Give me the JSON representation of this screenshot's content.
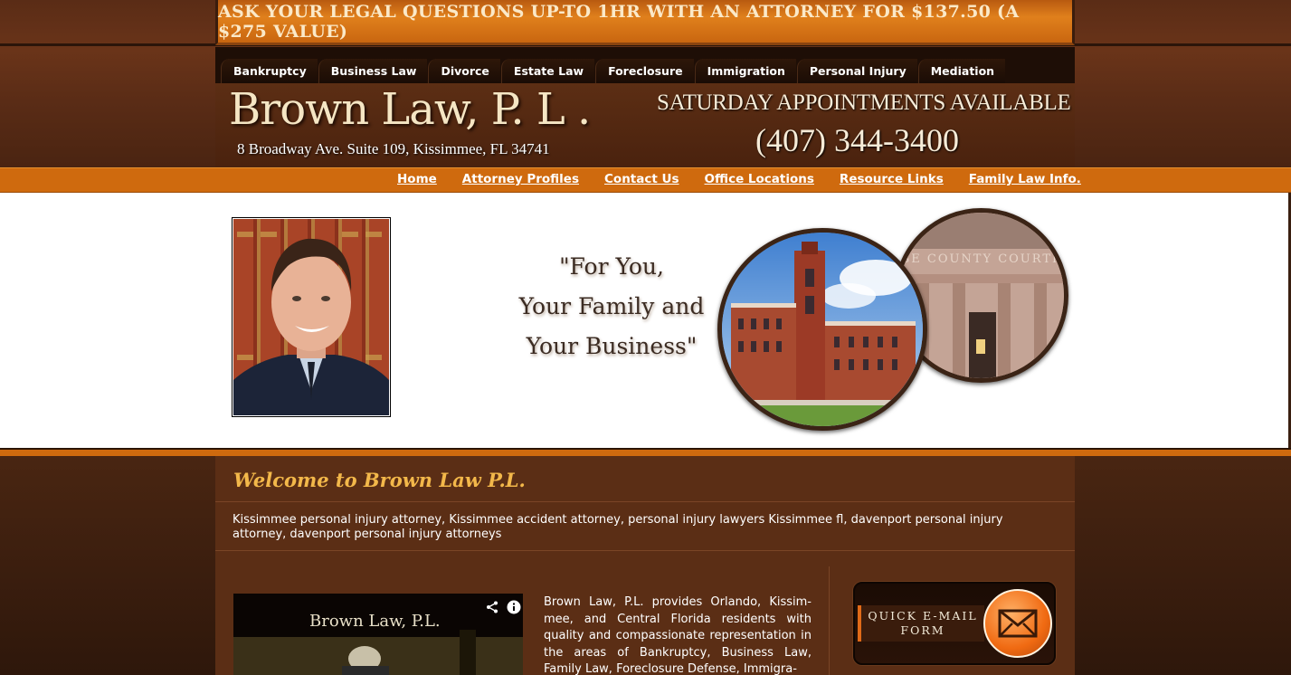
{
  "promo": {
    "text": "ASK YOUR LEGAL QUESTIONS UP-TO 1HR WITH AN ATTORNEY FOR $137.50 (A $275 VALUE)"
  },
  "practice_tabs": [
    "Bankruptcy",
    "Business Law",
    "Divorce",
    "Estate Law",
    "Foreclosure",
    "Immigration",
    "Personal Injury",
    "Mediation"
  ],
  "header": {
    "firm_name": "Brown Law, P. L .",
    "address": "8 Broadway Ave. Suite 109, Kissimmee, FL 34741",
    "saturday": "SATURDAY APPOINTMENTS AVAILABLE",
    "phone": "(407) 344-3400"
  },
  "nav": [
    "Home",
    "Attorney Profiles",
    "Contact Us",
    "Office Locations",
    "Resource Links",
    "Family Law Info."
  ],
  "hero": {
    "tagline": [
      "\"For You,",
      "Your Family and",
      "Your Business\""
    ],
    "courthouse_sign": "ORANGE COUNTY COURTHOUSE"
  },
  "content": {
    "welcome": "Welcome to Brown Law P.L.",
    "keywords": "Kissimmee personal injury attorney, Kissimmee accident attorney, personal injury lawyers Kissimmee fl, davenport personal injury attorney, davenport personal injury attorneys",
    "video_title": "Brown Law, P.L.",
    "intro": "Brown Law, P.L. provides Orlando, Kissim-mee, and Central Florida residents with quality and compassionate representation in the areas of Bankruptcy, Business Law, Family Law, Foreclosure Defense, Immigra-",
    "email_form": [
      "QUICK E-MAIL",
      "FORM"
    ]
  },
  "colors": {
    "accent_orange": "#cf6a0e",
    "welcome_gold": "#f3b84a",
    "brown_bg": "#5b2e15"
  }
}
